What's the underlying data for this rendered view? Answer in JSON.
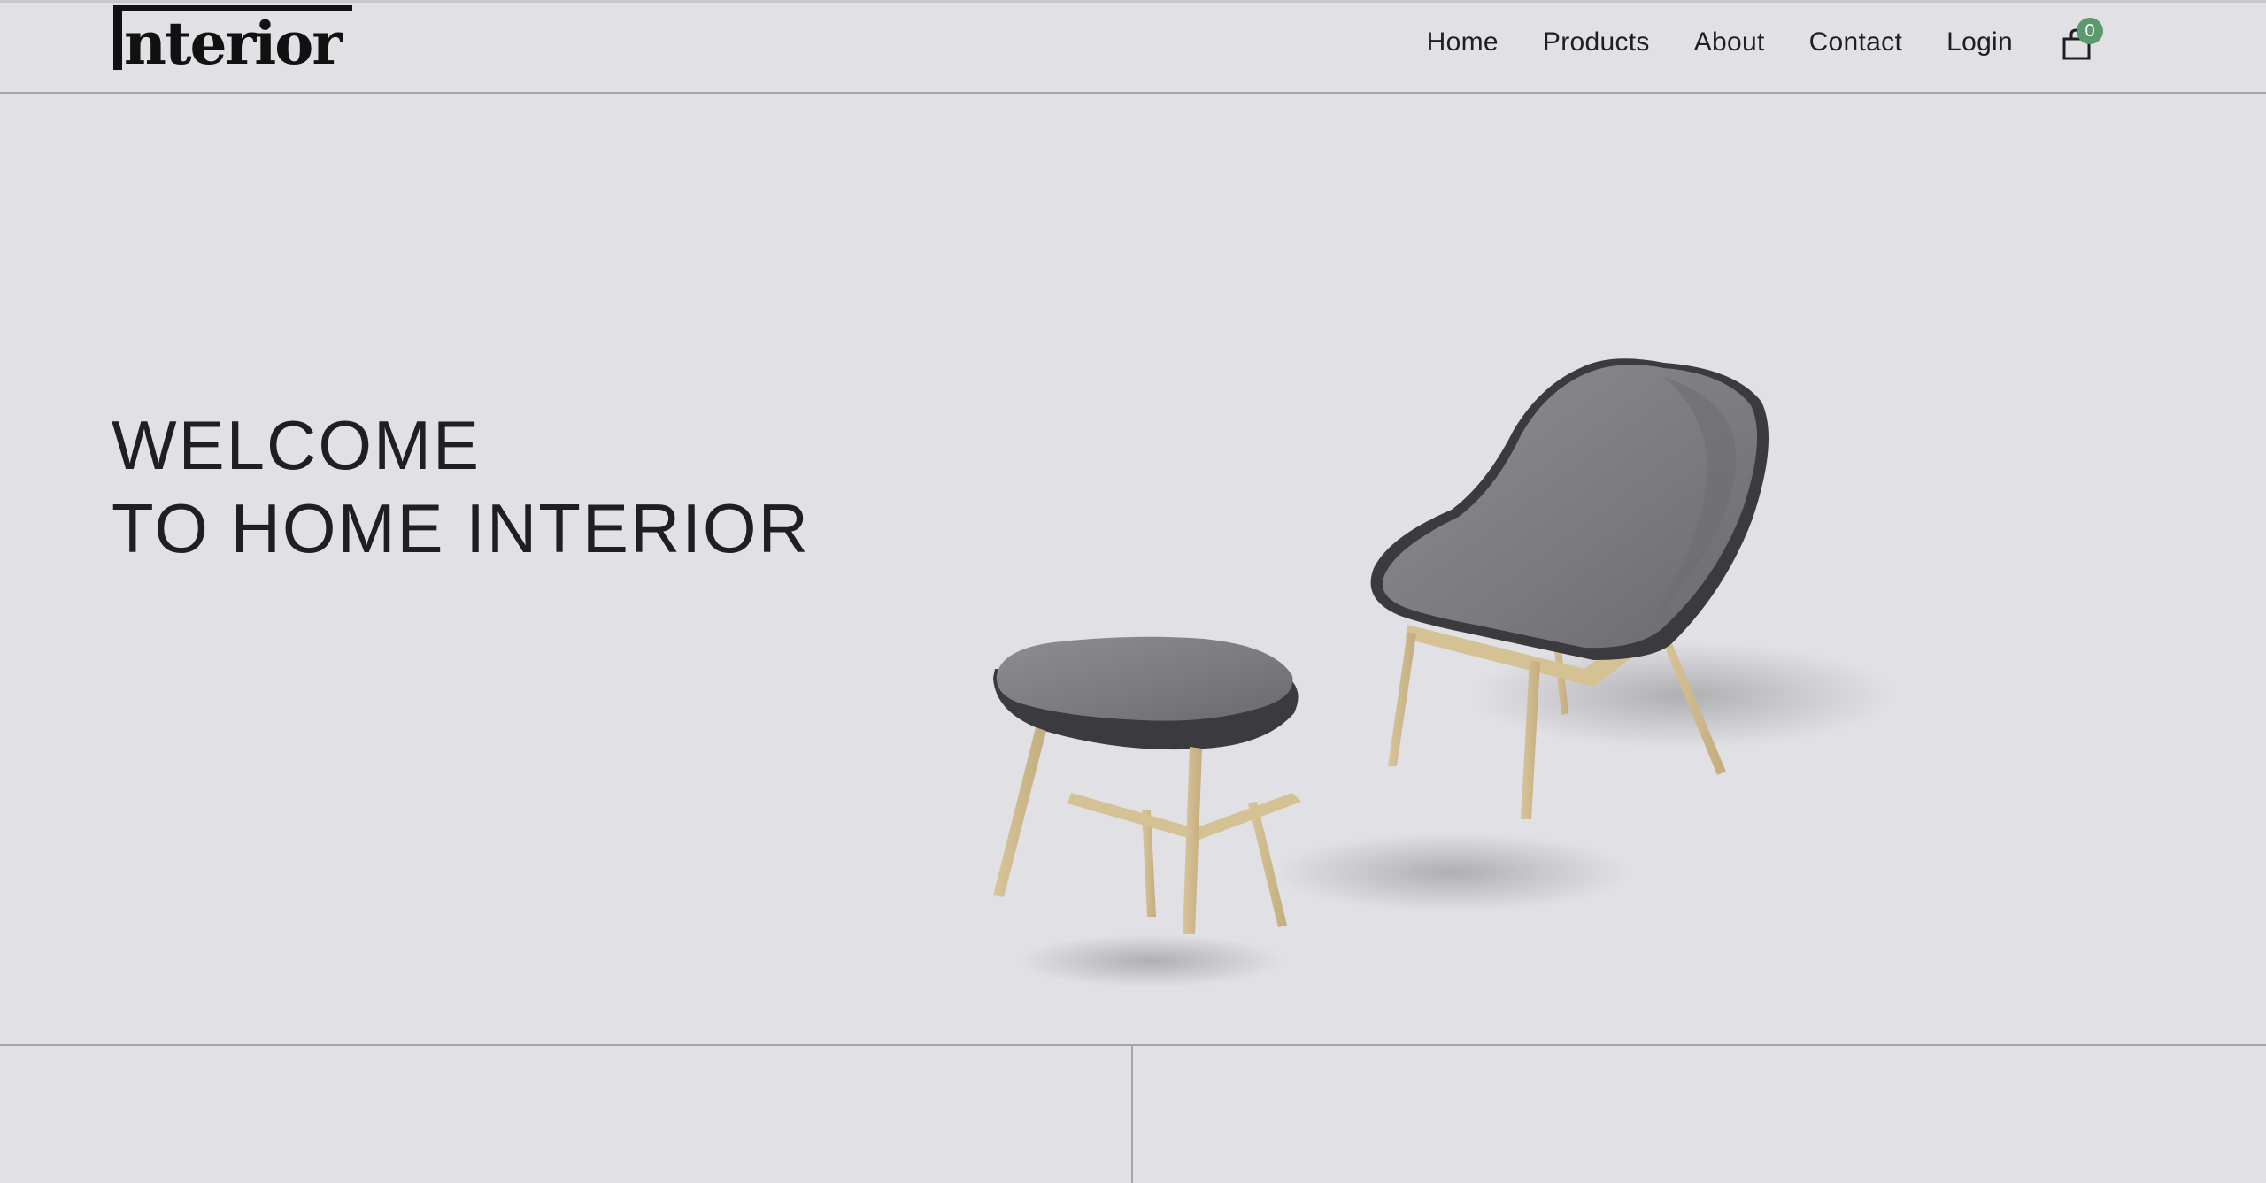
{
  "brand": {
    "logo_text": "nterior",
    "logo_word": "Interior"
  },
  "nav": {
    "items": [
      {
        "label": "Home"
      },
      {
        "label": "Products"
      },
      {
        "label": "About"
      },
      {
        "label": "Contact"
      },
      {
        "label": "Login"
      }
    ],
    "cart_icon": "shopping-bag-icon",
    "cart_count": "0"
  },
  "hero": {
    "title_line1": "WELCOME",
    "title_line2": "TO HOME INTERIOR",
    "image": "lounge-chair-and-ottoman"
  },
  "colors": {
    "background": "#e1e0e4",
    "text": "#1f1e22",
    "badge": "#5a9a6c"
  }
}
